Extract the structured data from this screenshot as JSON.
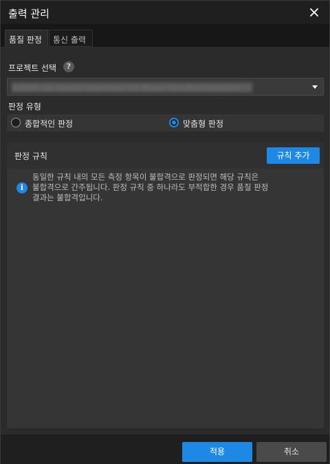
{
  "window": {
    "title": "출력 관리",
    "close_icon": "close-icon"
  },
  "tabs": [
    {
      "label": "품질 판정",
      "active": true
    },
    {
      "label": "통신 출력",
      "active": false
    }
  ],
  "project": {
    "label": "프로젝트 선택",
    "help_glyph": "?",
    "selected_value": "프로젝트 Vis_Defect_Inspection_for_Brake_Disc(Rust Analysis)"
  },
  "judgement_type": {
    "label": "판정 유형",
    "options": [
      {
        "label": "종합적인 판정",
        "checked": false
      },
      {
        "label": "맞춤형 판정",
        "checked": true
      }
    ]
  },
  "rules": {
    "title": "판정 규칙",
    "add_label": "규칙 추가",
    "info_glyph": "i",
    "info_text": "동일한 규칙 내의 모든 측정 항목이 불합격으로 판정되면 해당 규칙은\n불합격으로 간주됩니다. 판정 규칙 중 하나라도 부적합한 경우 품질 판정\n결과는 불합격입니다."
  },
  "footer": {
    "apply_label": "적용",
    "cancel_label": "취소"
  },
  "colors": {
    "accent": "#1e88e5",
    "background": "#2b2b2b",
    "titlebar": "#1f1f1f"
  }
}
